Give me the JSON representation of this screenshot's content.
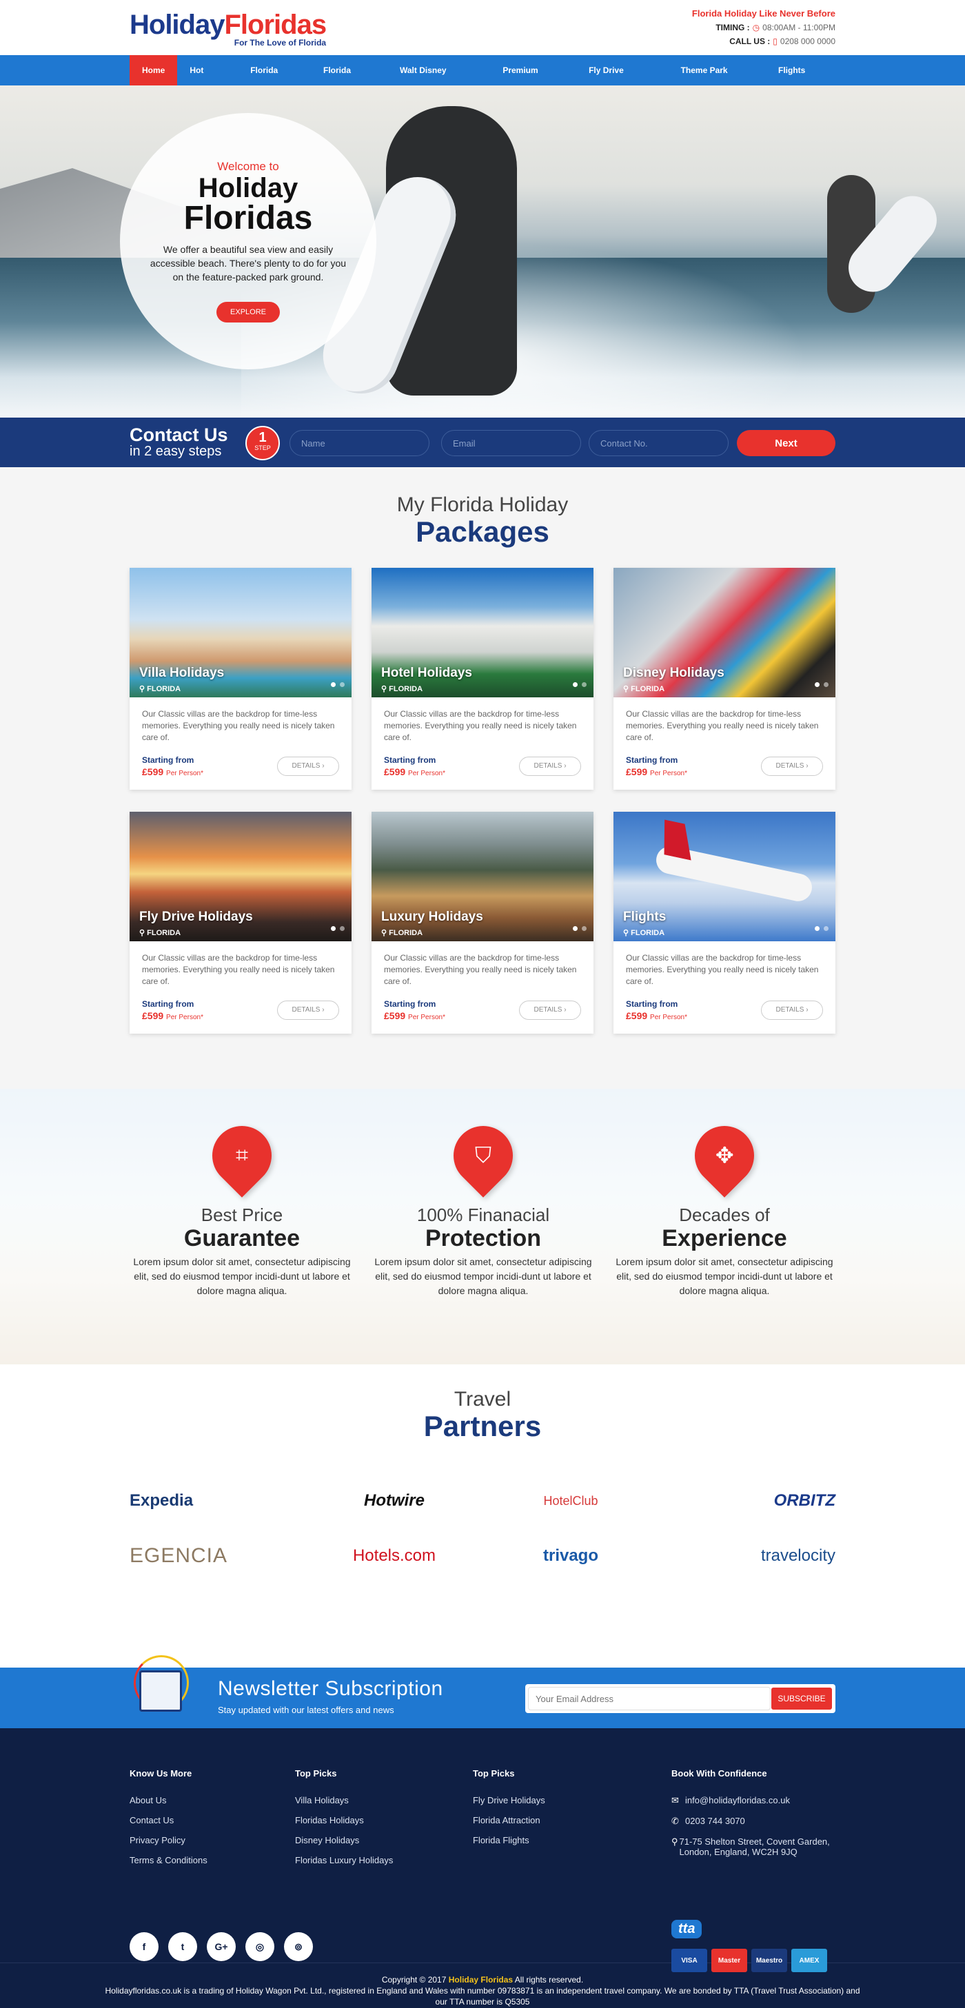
{
  "header": {
    "logo_part1": "Holiday",
    "logo_part2": "Floridas",
    "logo_tagline": "For The Love of Florida",
    "tagline": "Florida Holiday Like Never Before",
    "timing_label": "TIMING :",
    "timing_value": "08:00AM - 11:00PM",
    "call_label": "CALL US :",
    "call_value": "0208 000 0000"
  },
  "nav": {
    "items": [
      "Home",
      "Hot Deals",
      "Florida Villas",
      "Florida Hotels",
      "Walt Disney Holidays",
      "Premium Florida",
      "Fly Drive Holidays",
      "Theme Park Tickets",
      "Flights Only"
    ],
    "active": "Home"
  },
  "hero": {
    "welcome": "Welcome to",
    "title1": "Holiday",
    "title2": "Floridas",
    "text": "We offer a beautiful sea view and easily accessible beach. There's plenty to do for you on the feature-packed park ground.",
    "button": "EXPLORE"
  },
  "contact": {
    "title": "Contact Us",
    "subtitle": "in 2 easy steps",
    "step_num": "1",
    "step_label": "STEP",
    "name_placeholder": "Name",
    "email_placeholder": "Email",
    "phone_placeholder": "Contact No.",
    "next": "Next"
  },
  "packages": {
    "sub": "My Florida Holiday",
    "main": "Packages",
    "items": [
      {
        "title": "Villa Holidays",
        "location": "FLORIDA",
        "desc": "Our Classic villas are the backdrop for time-less memories. Everything you really need is nicely taken care of.",
        "starting": "Starting from",
        "price": "£599",
        "per": "Per Person*",
        "details": "DETAILS"
      },
      {
        "title": "Hotel Holidays",
        "location": "FLORIDA",
        "desc": "Our Classic villas are the backdrop for time-less memories. Everything you really need is nicely taken care of.",
        "starting": "Starting from",
        "price": "£599",
        "per": "Per Person*",
        "details": "DETAILS"
      },
      {
        "title": "Disney Holidays",
        "location": "FLORIDA",
        "desc": "Our Classic villas are the backdrop for time-less memories. Everything you really need is nicely taken care of.",
        "starting": "Starting from",
        "price": "£599",
        "per": "Per Person*",
        "details": "DETAILS"
      },
      {
        "title": "Fly Drive Holidays",
        "location": "FLORIDA",
        "desc": "Our Classic villas are the backdrop for time-less memories. Everything you really need is nicely taken care of.",
        "starting": "Starting from",
        "price": "£599",
        "per": "Per Person*",
        "details": "DETAILS"
      },
      {
        "title": "Luxury Holidays",
        "location": "FLORIDA",
        "desc": "Our Classic villas are the backdrop for time-less memories. Everything you really need is nicely taken care of.",
        "starting": "Starting from",
        "price": "£599",
        "per": "Per Person*",
        "details": "DETAILS"
      },
      {
        "title": "Flights",
        "location": "FLORIDA",
        "desc": "Our Classic villas are the backdrop for time-less memories. Everything you really need is nicely taken care of.",
        "starting": "Starting from",
        "price": "£599",
        "per": "Per Person*",
        "details": "DETAILS"
      }
    ]
  },
  "features": [
    {
      "icon": "price-tag-icon",
      "a": "Best Price",
      "b": "Guarantee",
      "text": "Lorem ipsum dolor sit amet, consectetur adipiscing elit, sed do eiusmod tempor incidi-dunt ut labore et dolore magna aliqua."
    },
    {
      "icon": "shield-check-icon",
      "a": "100% Finanacial",
      "b": "Protection",
      "text": "Lorem ipsum dolor sit amet, consectetur adipiscing elit, sed do eiusmod tempor incidi-dunt ut labore et dolore magna aliqua."
    },
    {
      "icon": "puzzle-icon",
      "a": "Decades of",
      "b": "Experience",
      "text": "Lorem ipsum dolor sit amet, consectetur adipiscing elit, sed do eiusmod tempor incidi-dunt ut labore et dolore magna aliqua."
    }
  ],
  "partners": {
    "sub": "Travel",
    "main": "Partners",
    "logos": [
      "Expedia",
      "Hotwire",
      "HotelClub",
      "ORBITZ",
      "EGENCIA",
      "Hotels.com",
      "trivago",
      "travelocity"
    ]
  },
  "newsletter": {
    "title": "Newsletter Subscription",
    "subtitle": "Stay updated with our latest offers and news",
    "placeholder": "Your Email Address",
    "button": "SUBSCRIBE"
  },
  "footer": {
    "col1_title": "Know Us More",
    "col1_links": [
      "About Us",
      "Contact Us",
      "Privacy Policy",
      "Terms & Conditions"
    ],
    "col2_title": "Top Picks",
    "col2_links": [
      "Villa Holidays",
      "Floridas Holidays",
      "Disney Holidays",
      "Floridas Luxury Holidays"
    ],
    "col3_title": "Top Picks",
    "col3_links": [
      "Fly Drive Holidays",
      "Florida Attraction",
      "Florida Flights"
    ],
    "col4_title": "Book With Confidence",
    "email": "info@holidayfloridas.co.uk",
    "phone": "0203 744 3070",
    "address": "71-75 Shelton Street, Covent Garden, London, England, WC2H 9JQ",
    "social": [
      "f",
      "t",
      "G+",
      "◎",
      "⊚"
    ],
    "tta": "tta",
    "cards": [
      "VISA",
      "Master",
      "Maestro",
      "AMEX"
    ]
  },
  "copyright": {
    "line1_a": "Copyright © 2017",
    "line1_brand": "Holiday Floridas",
    "line1_b": "All rights reserved.",
    "line2": "Holidayfloridas.co.uk is a trading of Holiday Wagon Pvt. Ltd., registered in England and Wales with number 09783871 is an independent travel company. We are bonded by TTA (Travel Trust Association) and",
    "line3": "our TTA number is Q5305"
  }
}
